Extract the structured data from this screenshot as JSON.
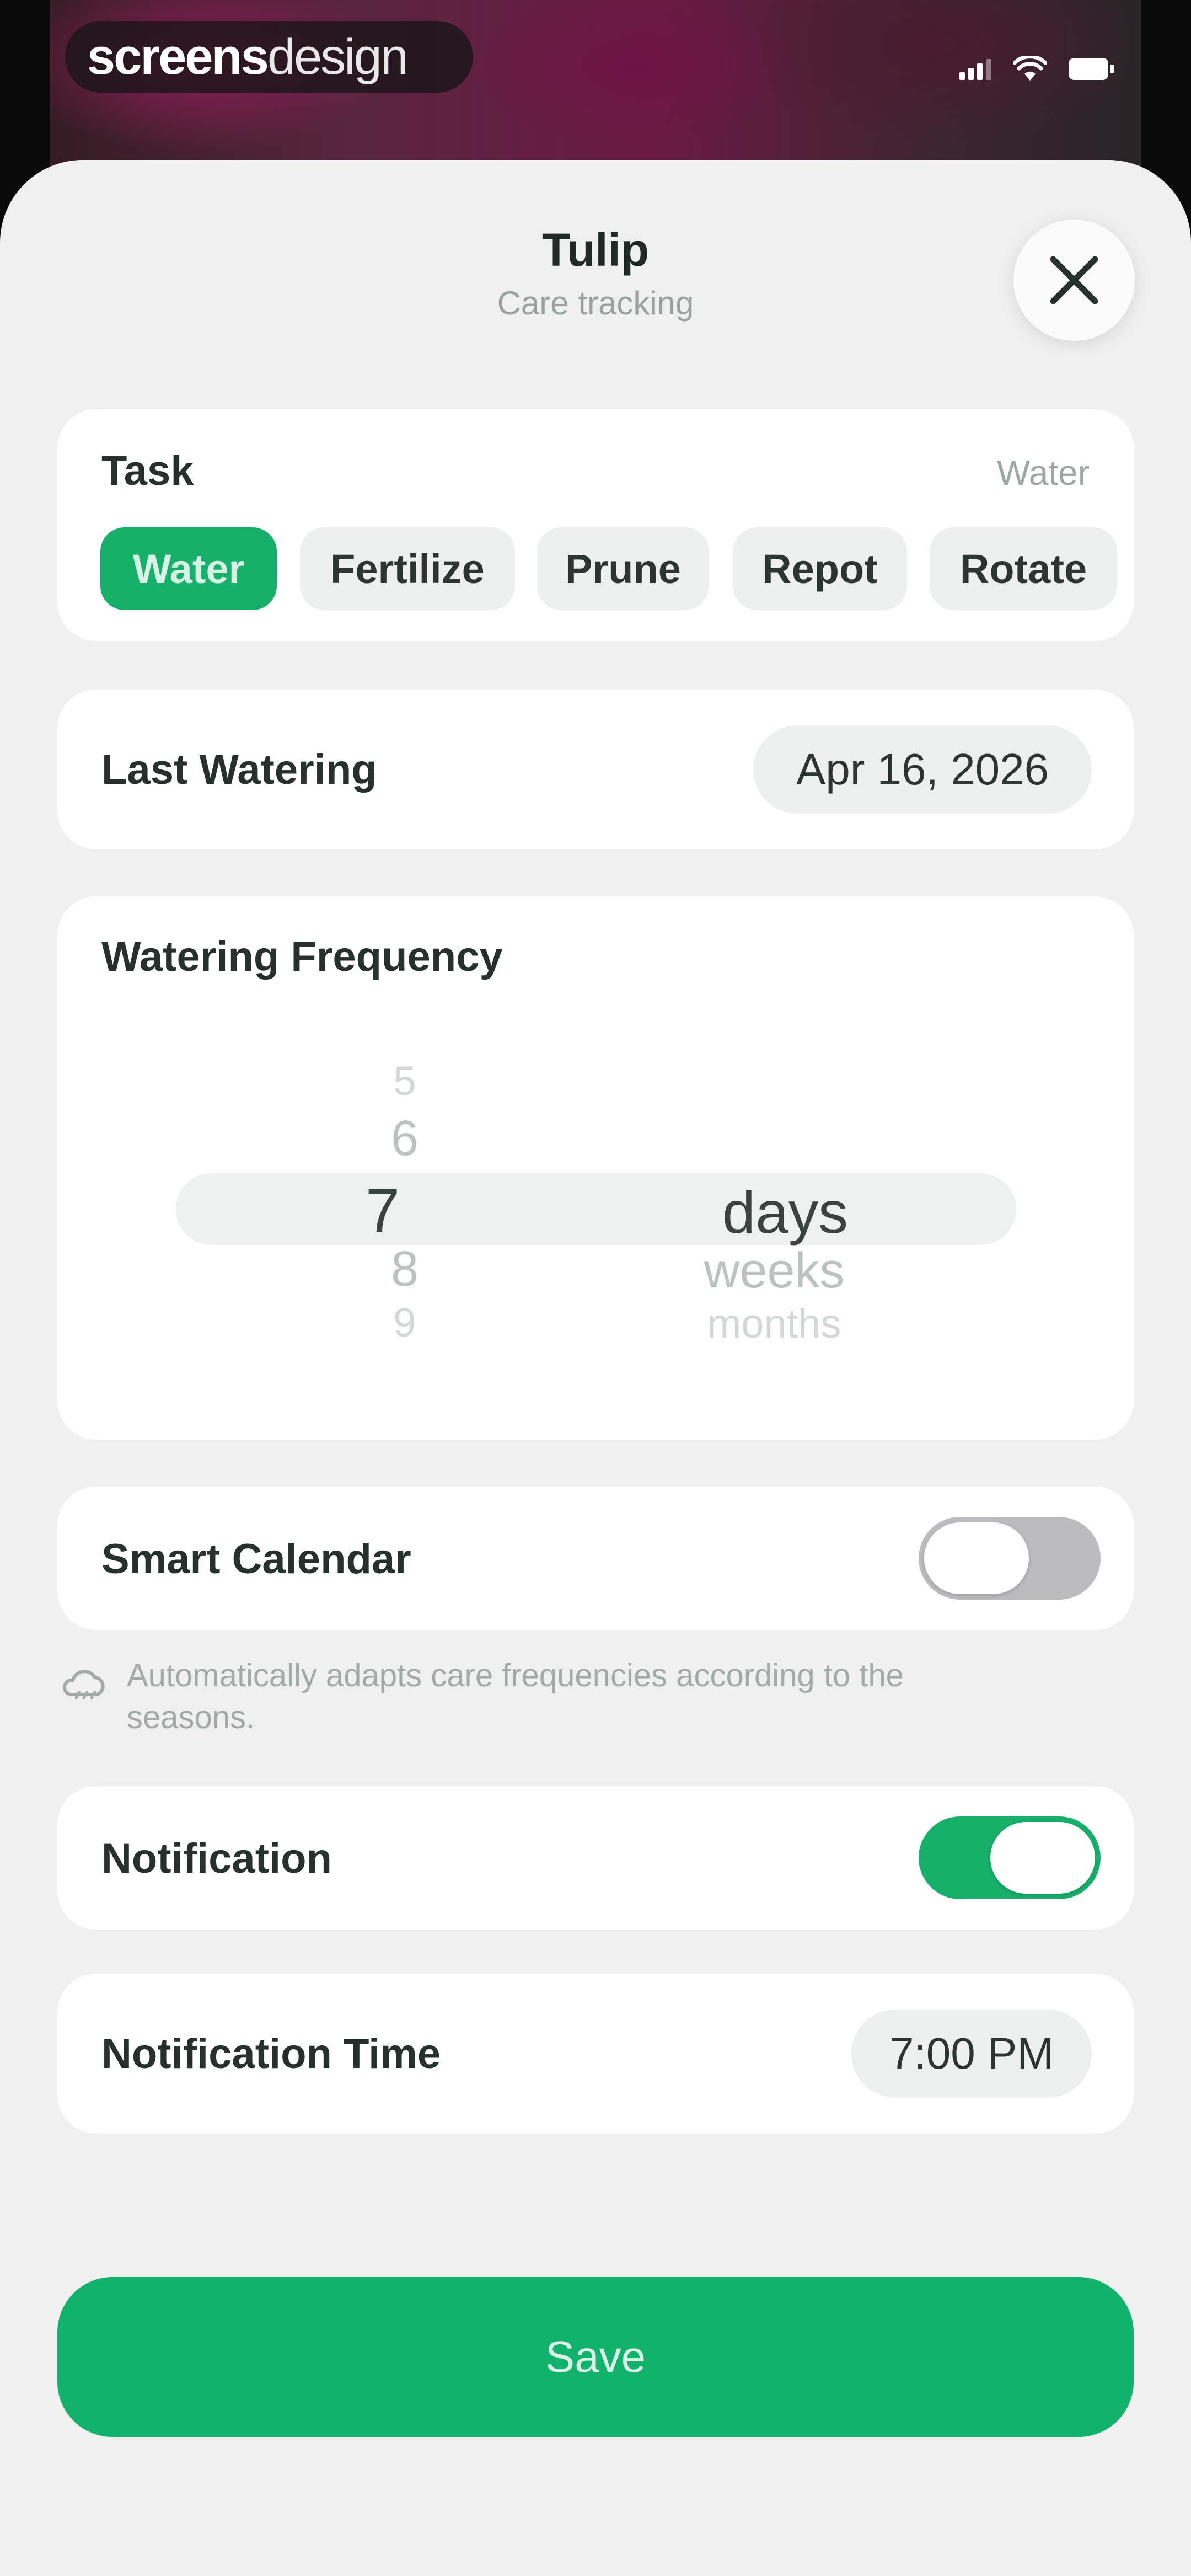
{
  "status_bar": {
    "brand_bold": "screens",
    "brand_light": "design"
  },
  "header": {
    "title": "Tulip",
    "subtitle": "Care tracking",
    "close_icon": "close-icon"
  },
  "task": {
    "label": "Task",
    "current_value": "Water",
    "options": [
      "Water",
      "Fertilize",
      "Prune",
      "Repot",
      "Rotate"
    ],
    "selected_index": 0
  },
  "last_watering": {
    "label": "Last Watering",
    "value": "Apr 16, 2026"
  },
  "frequency": {
    "label": "Watering Frequency",
    "numbers_above": [
      "5",
      "6"
    ],
    "number_selected": "7",
    "numbers_below": [
      "8",
      "9"
    ],
    "unit_selected": "days",
    "units_below": [
      "weeks",
      "months"
    ]
  },
  "smart_calendar": {
    "label": "Smart Calendar",
    "enabled": false,
    "hint": "Automatically adapts care frequencies according to the seasons.",
    "hint_icon": "weather-icon"
  },
  "notification": {
    "label": "Notification",
    "enabled": true
  },
  "notification_time": {
    "label": "Notification Time",
    "value": "7:00 PM"
  },
  "save": {
    "label": "Save"
  },
  "colors": {
    "accent": "#16b06b",
    "sheet_background": "#eff0ef",
    "card_background": "#ffffff"
  }
}
